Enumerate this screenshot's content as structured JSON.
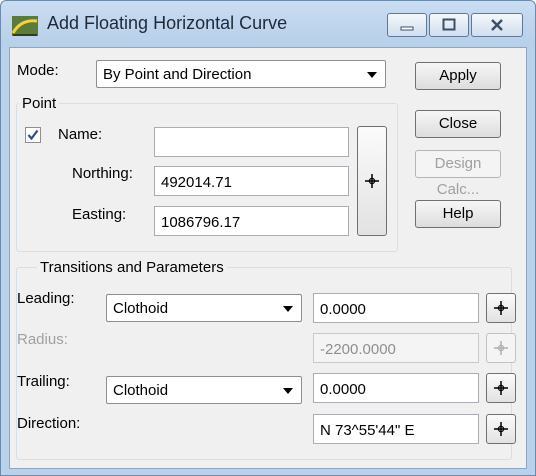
{
  "window": {
    "title": "Add Floating Horizontal Curve"
  },
  "mode": {
    "label": "Mode:",
    "value": "By Point and Direction"
  },
  "buttons": {
    "apply": "Apply",
    "close": "Close",
    "design_calc": "Design Calc...",
    "help": "Help"
  },
  "point_group": {
    "label": "Point",
    "name_label": "Name:",
    "name_checked": true,
    "name_value": "",
    "northing_label": "Northing:",
    "northing_value": "492014.71",
    "easting_label": "Easting:",
    "easting_value": "1086796.17"
  },
  "transitions_group": {
    "label": "Transitions and Parameters",
    "leading_label": "Leading:",
    "leading_value": "Clothoid",
    "leading_param": "0.0000",
    "radius_label": "Radius:",
    "radius_value": "-2200.0000",
    "trailing_label": "Trailing:",
    "trailing_value": "Clothoid",
    "trailing_param": "0.0000",
    "direction_label": "Direction:",
    "direction_value": "N 73^55'44\" E"
  },
  "icons": {
    "app": "curve-tool-icon",
    "pick": "crosshair-icon",
    "dropdown": "chevron-down-icon"
  },
  "colors": {
    "titlebar": "#b9d1ea",
    "dialog_bg": "#f0f0f0",
    "checkmark": "#2a4e8a"
  }
}
